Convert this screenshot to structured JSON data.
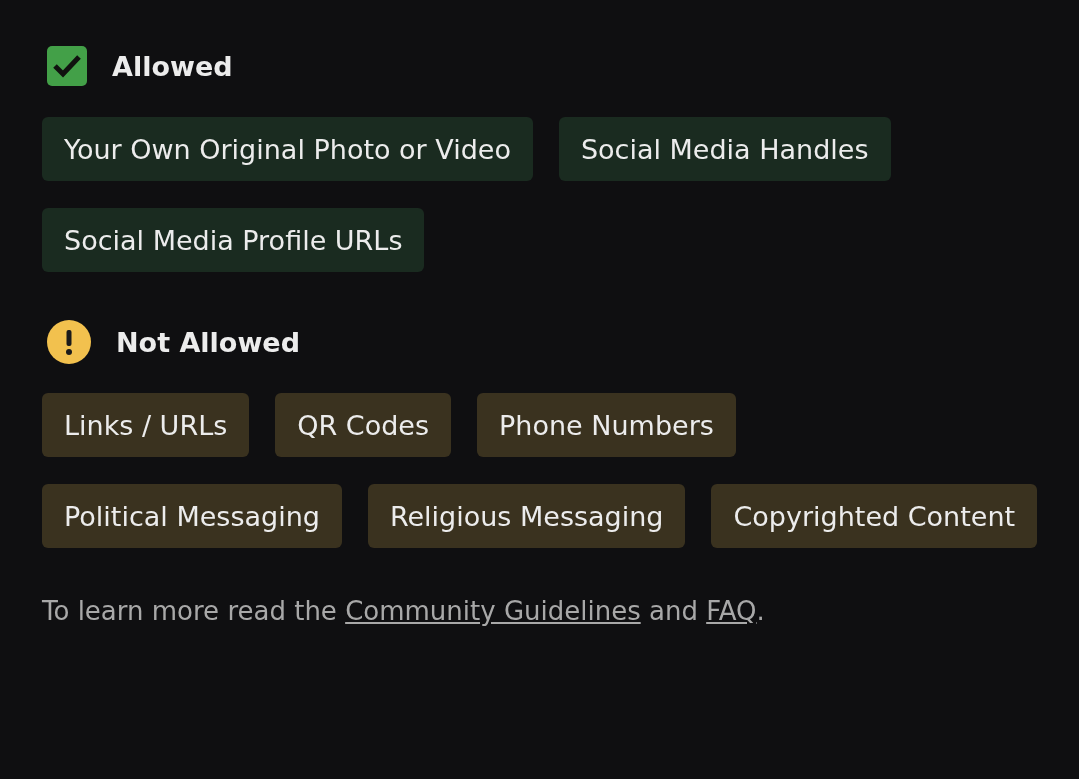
{
  "sections": [
    {
      "kind": "allowed",
      "title": "Allowed",
      "tags": [
        "Your Own Original Photo or Video",
        "Social Media Handles",
        "Social Media Profile URLs"
      ]
    },
    {
      "kind": "not_allowed",
      "title": "Not Allowed",
      "tags": [
        "Links / URLs",
        "QR Codes",
        "Phone Numbers",
        "Political Messaging",
        "Religious Messaging",
        "Copyrighted Content"
      ]
    }
  ],
  "footer": [
    {
      "kind": "text",
      "text": "To learn more read the "
    },
    {
      "kind": "link",
      "text": "Community Guidelines"
    },
    {
      "kind": "text",
      "text": " and "
    },
    {
      "kind": "link",
      "text": "FAQ"
    },
    {
      "kind": "text",
      "text": "."
    }
  ]
}
